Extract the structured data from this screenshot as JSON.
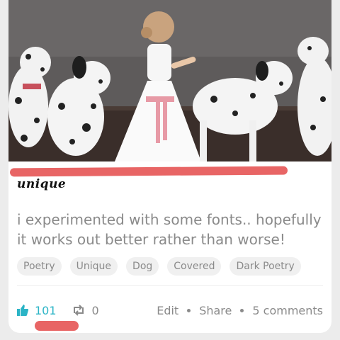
{
  "post": {
    "title": "unique",
    "description": "i experimented with some fonts.. hopefully it works out better rather than worse!",
    "tags": [
      "Poetry",
      "Unique",
      "Dog",
      "Covered",
      "Dark Poetry"
    ]
  },
  "actions": {
    "likes": "101",
    "reposts": "0",
    "edit_label": "Edit",
    "share_label": "Share",
    "comments_label": "5 comments"
  },
  "colors": {
    "accent": "#2bb4c6",
    "highlight": "#e86565",
    "muted_text": "#8a8a8a"
  },
  "icons": {
    "like": "thumbs-up-icon",
    "repost": "repost-icon"
  }
}
